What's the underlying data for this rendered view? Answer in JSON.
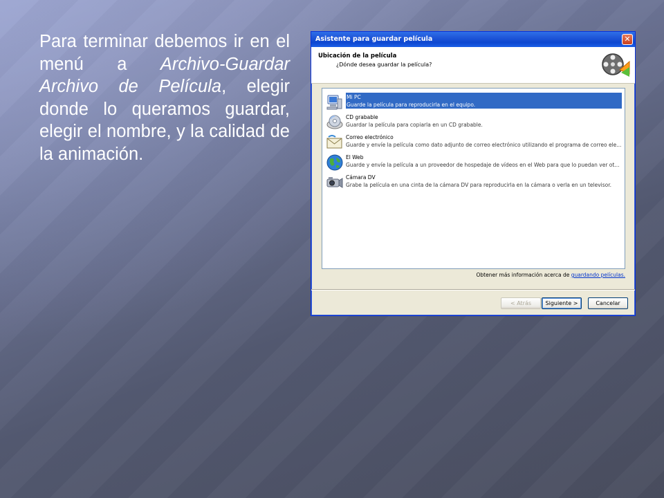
{
  "slide": {
    "text_intro": "Para terminar debemos ir en el menú a ",
    "text_em": "Archivo-Guardar Archivo de Película",
    "text_rest": ", elegir donde lo queramos guardar, elegir el nombre, y la calidad de la animación."
  },
  "dialog": {
    "title": "Asistente para guardar película",
    "close_glyph": "✕",
    "header_title": "Ubicación de la película",
    "header_sub": "¿Dónde desea guardar la película?",
    "options": [
      {
        "name": "Mi PC",
        "desc": "Guarde la película para reproducirla en el equipo.",
        "icon": "computer-icon",
        "selected": true
      },
      {
        "name": "CD grabable",
        "desc": "Guardar la película para copiarla en un CD grabable.",
        "icon": "cd-icon",
        "selected": false
      },
      {
        "name": "Correo electrónico",
        "desc": "Guarde y envíe la película como dato adjunto de correo electrónico utilizando el programa de correo ele...",
        "icon": "envelope-icon",
        "selected": false
      },
      {
        "name": "El Web",
        "desc": "Guarde y envíe la película a un proveedor de hospedaje de vídeos en el Web para que lo puedan ver ot...",
        "icon": "globe-icon",
        "selected": false
      },
      {
        "name": "Cámara DV",
        "desc": "Grabe la película en una cinta de la cámara DV para reproducirla en la cámara o verla en un televisor.",
        "icon": "camera-icon",
        "selected": false
      }
    ],
    "info_text": "Obtener más información acerca de ",
    "info_link": "guardando películas.",
    "buttons": {
      "back": "< Atrás",
      "next": "Siguiente >",
      "cancel": "Cancelar"
    }
  },
  "colors": {
    "titlebar": "#0d47d0",
    "selection": "#316ac5",
    "dialog_bg": "#ece9d8"
  }
}
